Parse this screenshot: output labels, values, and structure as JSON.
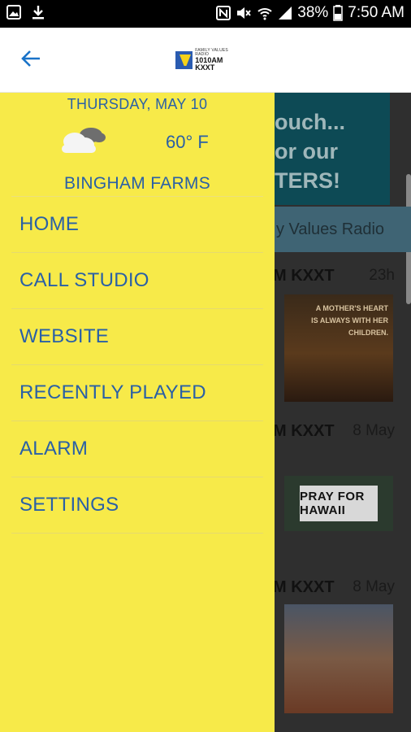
{
  "status_bar": {
    "battery": "38%",
    "time": "7:50 AM"
  },
  "app_bar": {
    "back_icon": "arrow-left-icon",
    "logo_line1": "FAMILY VALUES RADIO",
    "logo_line2": "1010AM KXXT"
  },
  "drawer": {
    "date": "THURSDAY, MAY 10",
    "temperature": "60° F",
    "location": "BINGHAM FARMS",
    "weather_icon": "cloudy-icon",
    "items": [
      {
        "label": "HOME"
      },
      {
        "label": "CALL STUDIO"
      },
      {
        "label": "WEBSITE"
      },
      {
        "label": "RECENTLY PLAYED"
      },
      {
        "label": "ALARM"
      },
      {
        "label": "SETTINGS"
      }
    ]
  },
  "background": {
    "promo_lines": [
      "ouch...",
      "or our",
      "TERS!"
    ],
    "channel": "y Values Radio",
    "posts": [
      {
        "source": "M KXXT",
        "time": "23h",
        "image_caption": "A MOTHER'S HEART IS ALWAYS WITH HER CHILDREN."
      },
      {
        "source": "M KXXT",
        "time": "8 May",
        "image_caption": "PRAY FOR HAWAII"
      },
      {
        "source": "M KXXT",
        "time": "8 May"
      }
    ]
  },
  "colors": {
    "drawer_bg": "#f7ea49",
    "drawer_text": "#2a60a6",
    "accent": "#1a73c8"
  }
}
